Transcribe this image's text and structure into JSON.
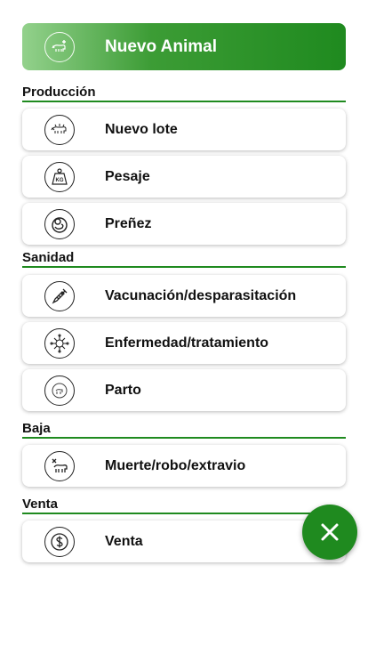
{
  "primary_action": {
    "label": "Nuevo Animal",
    "icon": "add-animal-icon"
  },
  "sections": {
    "produccion": {
      "title": "Producción",
      "items": [
        {
          "label": "Nuevo lote",
          "icon": "herd-icon"
        },
        {
          "label": "Pesaje",
          "icon": "weight-icon"
        },
        {
          "label": "Preñez",
          "icon": "pregnancy-icon"
        }
      ]
    },
    "sanidad": {
      "title": "Sanidad",
      "items": [
        {
          "label": "Vacunación/desparasitación",
          "icon": "syringe-icon"
        },
        {
          "label": "Enfermedad/tratamiento",
          "icon": "virus-icon"
        },
        {
          "label": "Parto",
          "icon": "birth-icon"
        }
      ]
    },
    "baja": {
      "title": "Baja",
      "items": [
        {
          "label": "Muerte/robo/extravio",
          "icon": "dead-animal-icon"
        }
      ]
    },
    "venta": {
      "title": "Venta",
      "items": [
        {
          "label": "Venta",
          "icon": "dollar-icon"
        }
      ]
    }
  },
  "fab": {
    "icon": "close-icon"
  },
  "colors": {
    "accent": "#1f8a1f",
    "accent_light": "#93d18c"
  }
}
